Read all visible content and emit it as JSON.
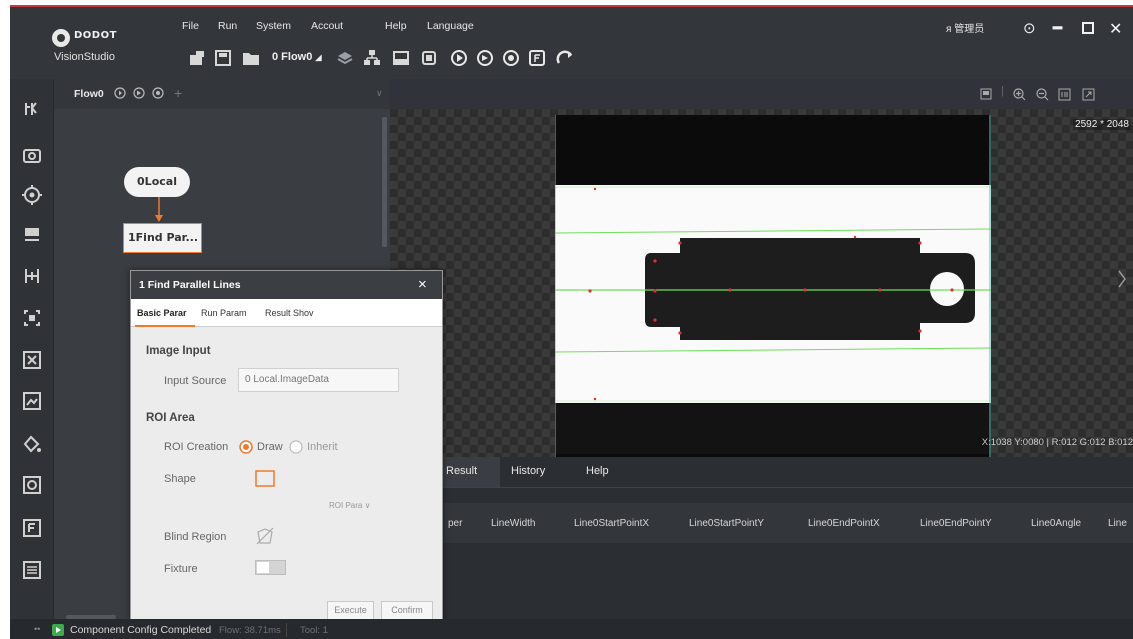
{
  "app": {
    "brand": "DODOT",
    "product": "VisionStudio",
    "accent_color": "#f07a2a",
    "window_controls": [
      "user-admin-icon",
      "settings-icon",
      "minimize-icon",
      "maximize-icon",
      "close-icon"
    ],
    "user_label": "管理员"
  },
  "menu": {
    "items": [
      "File",
      "Run",
      "System",
      "Accout",
      "Help",
      "Language"
    ]
  },
  "toolbar": {
    "flow_selector": "0 Flow0",
    "icons": [
      "new-solution-icon",
      "save-icon",
      "open-folder-icon",
      "flow-selector-dropdown",
      "layers-icon",
      "network-icon",
      "image-icon",
      "camera-device-icon",
      "run-once-icon",
      "run-loop-icon",
      "stop-icon",
      "panel-icon",
      "refresh-icon"
    ]
  },
  "flow_panel": {
    "tab_label": "Flow0",
    "add_tab": "+",
    "nodes": [
      {
        "label": "0Local"
      },
      {
        "label": "1Find Par..."
      }
    ]
  },
  "dialog": {
    "title": "1 Find Parallel Lines",
    "close": "×",
    "tabs": [
      "Basic Parar",
      "Run Param",
      "Result Shov"
    ],
    "active_tab": "Basic Parar",
    "image_input": {
      "section_title": "Image Input",
      "source_label": "Input Source",
      "source_value": "0 Local.ImageData"
    },
    "roi_area": {
      "section_title": "ROI Area",
      "creation_label": "ROI Creation",
      "option_draw": "Draw",
      "option_inherit": "Inherit",
      "selected": "Draw",
      "shape_label": "Shape",
      "roi_para_toggle": "ROI Para ∨",
      "blind_region_label": "Blind Region",
      "fixture_label": "Fixture",
      "fixture_enabled": false
    },
    "buttons": {
      "execute": "Execute",
      "confirm": "Confirm"
    }
  },
  "image_view": {
    "resolution": "2592 * 2048",
    "readout": "X:1038 Y:0080 | R:012 G:012 B:012",
    "line_color": "#6ee05a",
    "edge_point_color": "#e03030"
  },
  "result_panel": {
    "tabs": [
      "Result",
      "History",
      "Help"
    ],
    "active_tab": "Result",
    "columns": [
      "per",
      "LineWidth",
      "Line0StartPointX",
      "Line0StartPointY",
      "Line0EndPointX",
      "Line0EndPointY",
      "Line0Angle",
      "Line"
    ]
  },
  "status_bar": {
    "message": "Component Config Completed",
    "flow_time": "Flow: 38.71ms",
    "tool_time": "Tool: 1"
  }
}
